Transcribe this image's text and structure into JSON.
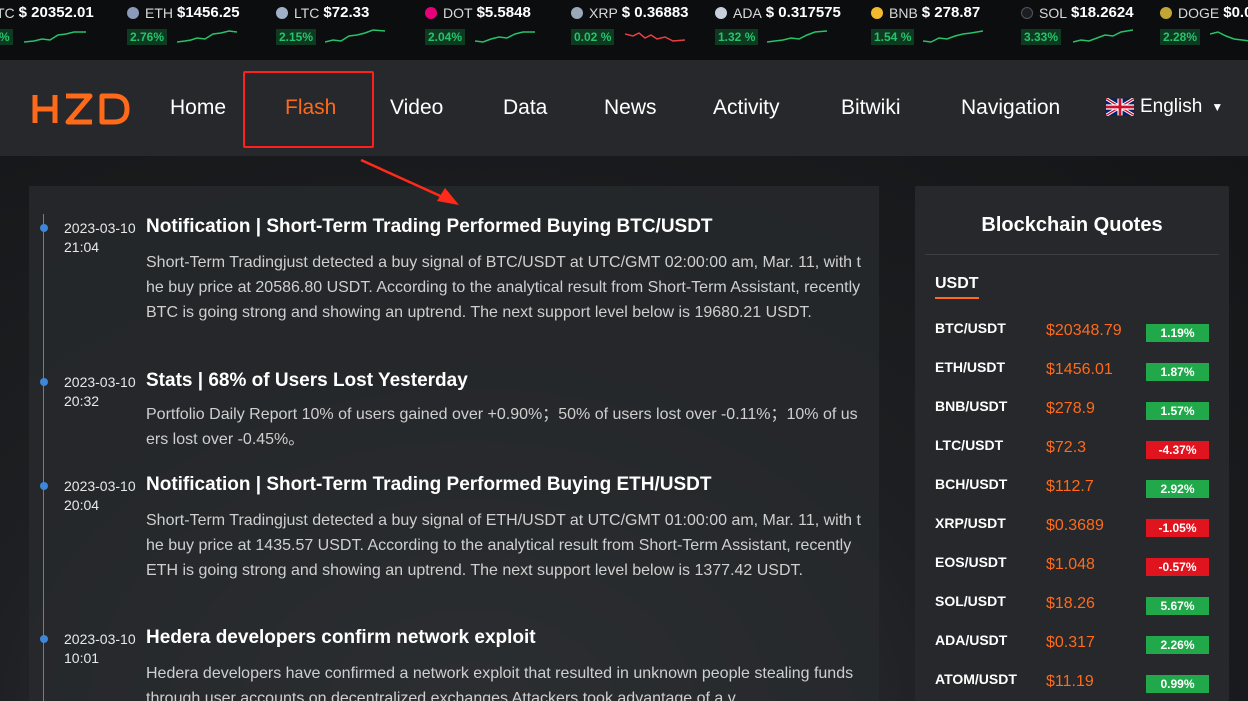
{
  "ticker": [
    {
      "sym": "TC",
      "price": "$ 20352.01",
      "pct": "%",
      "dir": "up",
      "icon_color": "#f7931a",
      "icon": "btc-icon",
      "spark": "up"
    },
    {
      "sym": "ETH",
      "price": "$1456.25",
      "pct": "2.76%",
      "dir": "up",
      "icon_color": "#8a9ab8",
      "icon": "eth-icon",
      "spark": "up"
    },
    {
      "sym": "LTC",
      "price": "$72.33",
      "pct": "2.15%",
      "dir": "up",
      "icon_color": "#9fb0c8",
      "icon": "ltc-icon",
      "spark": "up"
    },
    {
      "sym": "DOT",
      "price": "$5.5848",
      "pct": "2.04%",
      "dir": "up",
      "icon_color": "#e6007a",
      "icon": "dot-icon",
      "spark": "up"
    },
    {
      "sym": "XRP",
      "price": "$ 0.36883",
      "pct": "0.02 %",
      "dir": "up",
      "icon_color": "#9aa9b8",
      "icon": "xrp-icon",
      "spark": "down"
    },
    {
      "sym": "ADA",
      "price": "$ 0.317575",
      "pct": "1.32 %",
      "dir": "up",
      "icon_color": "#c8d0dc",
      "icon": "ada-icon",
      "spark": "up"
    },
    {
      "sym": "BNB",
      "price": "$ 278.87",
      "pct": "1.54 %",
      "dir": "up",
      "icon_color": "#f3ba2f",
      "icon": "bnb-icon",
      "spark": "up"
    },
    {
      "sym": "SOL",
      "price": "$18.2624",
      "pct": "3.33%",
      "dir": "up",
      "icon_color": "#1a1d22",
      "icon": "sol-icon",
      "spark": "up"
    },
    {
      "sym": "DOGE",
      "price": "$0.0",
      "pct": "2.28%",
      "dir": "up",
      "icon_color": "#c2a633",
      "icon": "doge-icon",
      "spark": "up"
    }
  ],
  "header": {
    "logo": "HZD",
    "nav": [
      "Home",
      "Flash",
      "Video",
      "Data",
      "News",
      "Activity",
      "Bitwiki",
      "Navigation"
    ],
    "active_nav": "Flash",
    "language": "English",
    "accent_color": "#ff6a1a",
    "highlight_color": "#ff1f1f"
  },
  "feed": [
    {
      "date": "2023-03-10 21:04",
      "title": "Notification | Short-Term Trading Performed Buying BTC/USDT",
      "body": "Short-Term Tradingjust detected a buy signal of BTC/USDT at UTC/GMT 02:00:00 am, Mar. 11, with the buy price at 20586.80 USDT. According to the analytical result from Short-Term Assistant, recently BTC is going strong and showing an uptrend. The next support level below is 19680.21 USDT."
    },
    {
      "date": "2023-03-10 20:32",
      "title": "Stats | 68% of Users Lost Yesterday",
      "body": "Portfolio Daily Report 10% of users gained over +0.90%；50% of users lost over -0.11%；10% of users lost over -0.45%。"
    },
    {
      "date": "2023-03-10 20:04",
      "title": "Notification | Short-Term Trading Performed Buying ETH/USDT",
      "body": "Short-Term Tradingjust detected a buy signal of ETH/USDT at UTC/GMT 01:00:00 am, Mar. 11, with the buy price at 1435.57 USDT. According to the analytical result from Short-Term Assistant, recently ETH is going strong and showing an uptrend. The next support level below is 1377.42 USDT."
    },
    {
      "date": "2023-03-10 10:01",
      "title": "Hedera developers confirm network exploit",
      "body": "Hedera developers have confirmed a network exploit that resulted in unknown people stealing funds through user accounts on decentralized exchanges Attackers took advantage of a v"
    }
  ],
  "quotes": {
    "title": "Blockchain Quotes",
    "tab": "USDT",
    "rows": [
      {
        "pair": "BTC/USDT",
        "price": "$20348.79",
        "change": "1.19%",
        "dir": "up"
      },
      {
        "pair": "ETH/USDT",
        "price": "$1456.01",
        "change": "1.87%",
        "dir": "up"
      },
      {
        "pair": "BNB/USDT",
        "price": "$278.9",
        "change": "1.57%",
        "dir": "up"
      },
      {
        "pair": "LTC/USDT",
        "price": "$72.3",
        "change": "-4.37%",
        "dir": "down"
      },
      {
        "pair": "BCH/USDT",
        "price": "$112.7",
        "change": "2.92%",
        "dir": "up"
      },
      {
        "pair": "XRP/USDT",
        "price": "$0.3689",
        "change": "-1.05%",
        "dir": "down"
      },
      {
        "pair": "EOS/USDT",
        "price": "$1.048",
        "change": "-0.57%",
        "dir": "down"
      },
      {
        "pair": "SOL/USDT",
        "price": "$18.26",
        "change": "5.67%",
        "dir": "up"
      },
      {
        "pair": "ADA/USDT",
        "price": "$0.317",
        "change": "2.26%",
        "dir": "up"
      },
      {
        "pair": "ATOM/USDT",
        "price": "$11.19",
        "change": "0.99%",
        "dir": "up"
      }
    ],
    "up_color": "#21a84a",
    "down_color": "#e0141e"
  }
}
